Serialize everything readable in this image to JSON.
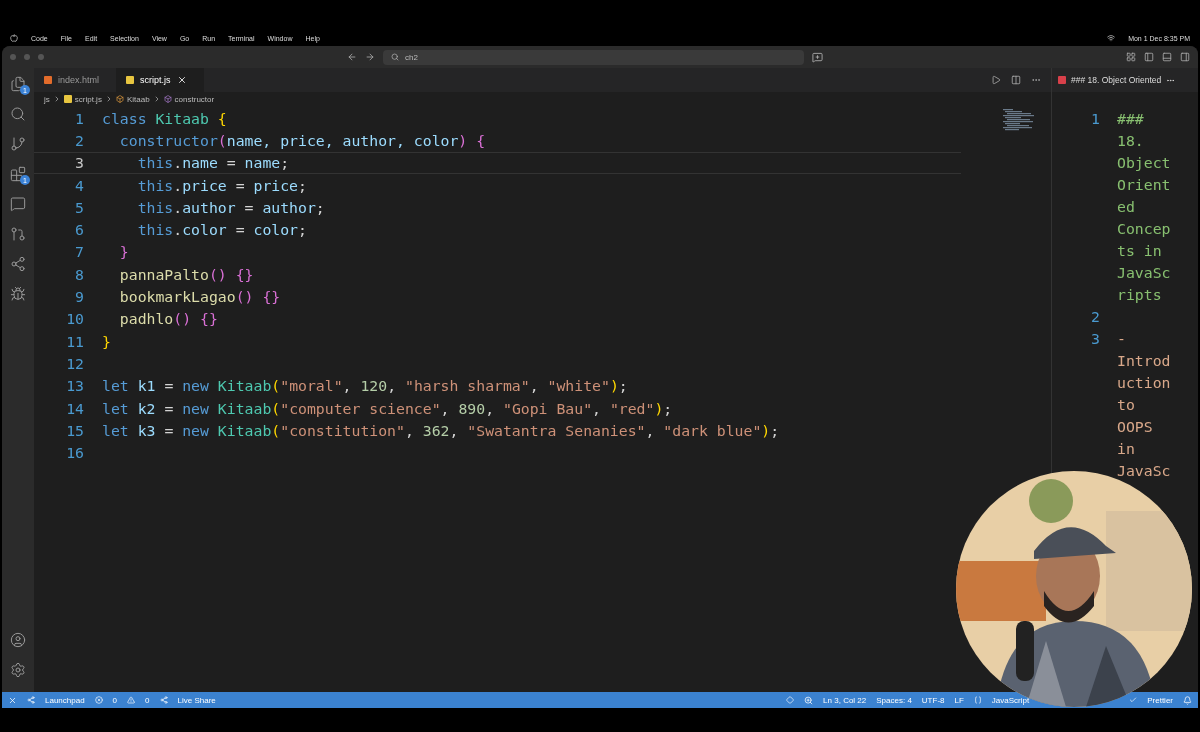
{
  "menu_bar": {
    "items": [
      "Code",
      "File",
      "Edit",
      "Selection",
      "View",
      "Go",
      "Run",
      "Terminal",
      "Window",
      "Help"
    ],
    "clock": "Mon 1 Dec  8:35 PM"
  },
  "title_bar": {
    "search": "ch2"
  },
  "activity_bar": {
    "badges": [
      "1",
      "1"
    ]
  },
  "tabs": [
    {
      "label": "index.html",
      "kind": "html",
      "selected": false
    },
    {
      "label": "script.js",
      "kind": "js",
      "selected": true
    }
  ],
  "breadcrumb": [
    "js",
    "script.js",
    "Kitaab",
    "constructor"
  ],
  "code": {
    "lines": [
      {
        "number": "1",
        "current": false,
        "tokens": [
          {
            "kind": "keyword",
            "text": "class "
          },
          {
            "kind": "class",
            "text": "Kitaab "
          },
          {
            "kind": "brace1",
            "text": "{"
          }
        ]
      },
      {
        "number": "2",
        "current": false,
        "tokens": [
          {
            "kind": "keyword",
            "text": "  constructor"
          },
          {
            "kind": "brace2",
            "text": "("
          },
          {
            "kind": "param",
            "text": "name, price, author, color"
          },
          {
            "kind": "brace2",
            "text": ") {"
          }
        ]
      },
      {
        "number": "3",
        "current": true,
        "tokens": [
          {
            "kind": "keyword",
            "text": "    this"
          },
          {
            "kind": "plain",
            "text": "."
          },
          {
            "kind": "param",
            "text": "name"
          },
          {
            "kind": "plain",
            "text": " = "
          },
          {
            "kind": "param",
            "text": "name"
          },
          {
            "kind": "plain",
            "text": ";"
          }
        ]
      },
      {
        "number": "4",
        "current": false,
        "tokens": [
          {
            "kind": "keyword",
            "text": "    this"
          },
          {
            "kind": "plain",
            "text": "."
          },
          {
            "kind": "param",
            "text": "price"
          },
          {
            "kind": "plain",
            "text": " = "
          },
          {
            "kind": "param",
            "text": "price"
          },
          {
            "kind": "plain",
            "text": ";"
          }
        ]
      },
      {
        "number": "5",
        "current": false,
        "tokens": [
          {
            "kind": "keyword",
            "text": "    this"
          },
          {
            "kind": "plain",
            "text": "."
          },
          {
            "kind": "param",
            "text": "author"
          },
          {
            "kind": "plain",
            "text": " = "
          },
          {
            "kind": "param",
            "text": "author"
          },
          {
            "kind": "plain",
            "text": ";"
          }
        ]
      },
      {
        "number": "6",
        "current": false,
        "tokens": [
          {
            "kind": "keyword",
            "text": "    this"
          },
          {
            "kind": "plain",
            "text": "."
          },
          {
            "kind": "param",
            "text": "color"
          },
          {
            "kind": "plain",
            "text": " = "
          },
          {
            "kind": "param",
            "text": "color"
          },
          {
            "kind": "plain",
            "text": ";"
          }
        ]
      },
      {
        "number": "7",
        "current": false,
        "tokens": [
          {
            "kind": "brace2",
            "text": "  }"
          }
        ]
      },
      {
        "number": "8",
        "current": false,
        "tokens": [
          {
            "kind": "method",
            "text": "  pannaPalto"
          },
          {
            "kind": "brace2",
            "text": "() "
          },
          {
            "kind": "brace2",
            "text": "{}"
          }
        ]
      },
      {
        "number": "9",
        "current": false,
        "tokens": [
          {
            "kind": "method",
            "text": "  bookmarkLagao"
          },
          {
            "kind": "brace2",
            "text": "() "
          },
          {
            "kind": "brace2",
            "text": "{}"
          }
        ]
      },
      {
        "number": "10",
        "current": false,
        "tokens": [
          {
            "kind": "method",
            "text": "  padhlo"
          },
          {
            "kind": "brace2",
            "text": "() "
          },
          {
            "kind": "brace2",
            "text": "{}"
          }
        ]
      },
      {
        "number": "11",
        "current": false,
        "tokens": [
          {
            "kind": "brace1",
            "text": "}"
          }
        ]
      },
      {
        "number": "12",
        "current": false
      },
      {
        "number": "13",
        "current": false,
        "tokens": [
          {
            "kind": "keyword",
            "text": "let "
          },
          {
            "kind": "param",
            "text": "k1"
          },
          {
            "kind": "plain",
            "text": " = "
          },
          {
            "kind": "keyword",
            "text": "new "
          },
          {
            "kind": "class",
            "text": "Kitaab"
          },
          {
            "kind": "brace1",
            "text": "("
          },
          {
            "kind": "string",
            "text": "\"moral\""
          },
          {
            "kind": "plain",
            "text": ", "
          },
          {
            "kind": "number",
            "text": "120"
          },
          {
            "kind": "plain",
            "text": ", "
          },
          {
            "kind": "string",
            "text": "\"harsh sharma\""
          },
          {
            "kind": "plain",
            "text": ", "
          },
          {
            "kind": "string",
            "text": "\"white\""
          },
          {
            "kind": "brace1",
            "text": ")"
          },
          {
            "kind": "plain",
            "text": ";"
          }
        ]
      },
      {
        "number": "14",
        "current": false,
        "tokens": [
          {
            "kind": "keyword",
            "text": "let "
          },
          {
            "kind": "param",
            "text": "k2"
          },
          {
            "kind": "plain",
            "text": " = "
          },
          {
            "kind": "keyword",
            "text": "new "
          },
          {
            "kind": "class",
            "text": "Kitaab"
          },
          {
            "kind": "brace1",
            "text": "("
          },
          {
            "kind": "string",
            "text": "\"computer science\""
          },
          {
            "kind": "plain",
            "text": ", "
          },
          {
            "kind": "number",
            "text": "890"
          },
          {
            "kind": "plain",
            "text": ", "
          },
          {
            "kind": "string",
            "text": "\"Gopi Bau\""
          },
          {
            "kind": "plain",
            "text": ", "
          },
          {
            "kind": "string",
            "text": "\"red\""
          },
          {
            "kind": "brace1",
            "text": ")"
          },
          {
            "kind": "plain",
            "text": ";"
          }
        ]
      },
      {
        "number": "15",
        "current": false,
        "tokens": [
          {
            "kind": "keyword",
            "text": "let "
          },
          {
            "kind": "param",
            "text": "k3"
          },
          {
            "kind": "plain",
            "text": " = "
          },
          {
            "kind": "keyword",
            "text": "new "
          },
          {
            "kind": "class",
            "text": "Kitaab"
          },
          {
            "kind": "brace1",
            "text": "("
          },
          {
            "kind": "string",
            "text": "\"constitution\""
          },
          {
            "kind": "plain",
            "text": ", "
          },
          {
            "kind": "number",
            "text": "362"
          },
          {
            "kind": "plain",
            "text": ", "
          },
          {
            "kind": "string",
            "text": "\"Swatantra Senanies\""
          },
          {
            "kind": "plain",
            "text": ", "
          },
          {
            "kind": "string",
            "text": "\"dark blue\""
          },
          {
            "kind": "brace1",
            "text": ")"
          },
          {
            "kind": "plain",
            "text": ";"
          }
        ]
      },
      {
        "number": "16",
        "current": false
      }
    ]
  },
  "preview": {
    "tab": "### 18. Object Oriented",
    "lines": [
      {
        "number": "1",
        "kind": "heading",
        "text": "### 18. Object Oriented Concepts in JavaScripts"
      },
      {
        "number": "2"
      },
      {
        "number": "3",
        "kind": "list",
        "text": "- Introduction to OOPS in JavaSc"
      }
    ]
  },
  "status_bar": {
    "left": {
      "launchpad": "Launchpad",
      "errors": "0",
      "warnings": "0",
      "live_share": "Live Share"
    },
    "right": {
      "position": "Ln 3, Col 22",
      "spaces": "Spaces: 4",
      "encoding": "UTF-8",
      "eol": "LF",
      "language": "JavaScript",
      "formatter": "Prettier"
    }
  }
}
